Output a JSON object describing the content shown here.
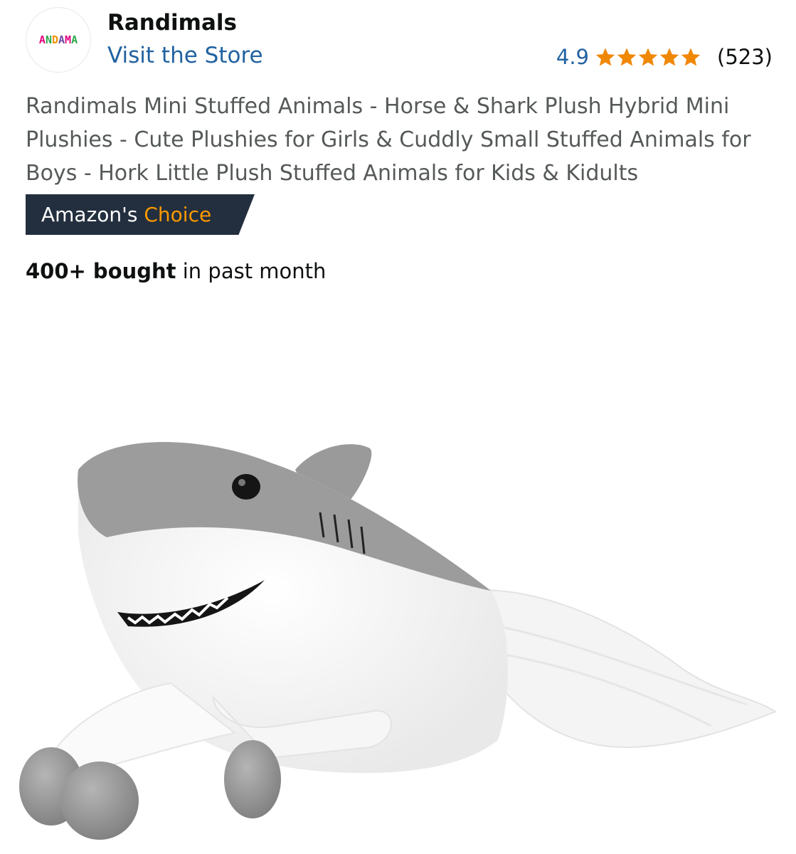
{
  "store": {
    "logo_text": "ANDAMA",
    "name": "Randimals",
    "visit_link": "Visit the Store"
  },
  "rating": {
    "value": "4.9",
    "stars": 5,
    "count": "(523)",
    "star_color": "#f08804"
  },
  "product": {
    "title": "Randimals Mini Stuffed Animals - Horse & Shark Plush Hybrid Mini Plushies - Cute Plushies for Girls & Cuddly Small Stuffed Animals for Boys - Hork Little Plush Stuffed Animals for Kids & Kidults",
    "badge_prefix": "Amazon's",
    "badge_highlight": "Choice",
    "bought_bold": "400+ bought",
    "bought_rest": "in past month",
    "image_alt": "shark-horse-plush-image"
  },
  "colors": {
    "link": "#2162a1",
    "badge_bg": "#232f3e",
    "badge_accent": "#ff9900"
  }
}
